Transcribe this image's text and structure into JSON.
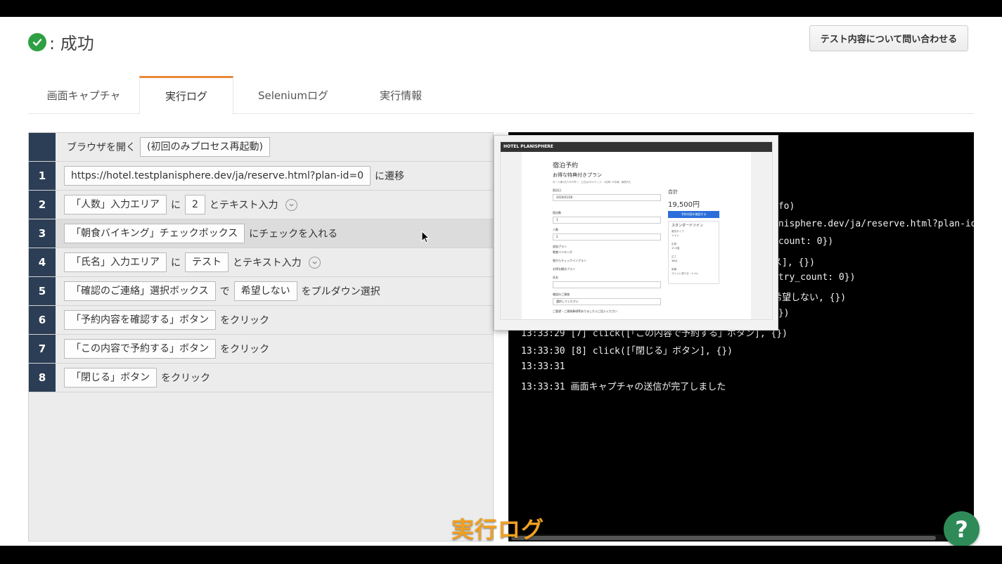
{
  "status": {
    "label": ": 成功"
  },
  "contact_button": {
    "label": "テスト内容について問い合わせる"
  },
  "tabs": [
    {
      "label": "画面キャプチャ"
    },
    {
      "label": "実行ログ",
      "active": true
    },
    {
      "label": "Seleniumログ"
    },
    {
      "label": "実行情報"
    }
  ],
  "steps": [
    {
      "num": "",
      "parts": [
        "ブラウザを開く",
        "(初回のみプロセス再起動)"
      ]
    },
    {
      "num": "1",
      "parts": [
        "https://hotel.testplanisphere.dev/ja/reserve.html?plan-id=0",
        "に遷移"
      ]
    },
    {
      "num": "2",
      "parts": [
        "「人数」入力エリア",
        "に",
        "2",
        "とテキスト入力"
      ]
    },
    {
      "num": "3",
      "parts": [
        "「朝食バイキング」チェックボックス",
        "にチェックを入れる"
      ]
    },
    {
      "num": "4",
      "parts": [
        "「氏名」入力エリア",
        "に",
        "テスト",
        "とテキスト入力"
      ]
    },
    {
      "num": "5",
      "parts": [
        "「確認のご連絡」選択ボックス",
        "で",
        "希望しない",
        "をプルダウン選択"
      ]
    },
    {
      "num": "6",
      "parts": [
        "「予約内容を確認する」ボタン",
        "をクリック"
      ]
    },
    {
      "num": "7",
      "parts": [
        "「この内容で予約する」ボタン",
        "をクリック"
      ]
    },
    {
      "num": "8",
      "parts": [
        "「閉じる」ボタン",
        "をクリック"
      ]
    }
  ],
  "log": {
    "lines": [
      "nfo)",
      "anisphere.dev/ja/reserve.html?plan-id",
      "_count: 0})",
      "ス], {})",
      "etry_count: 0})",
      "希望しない, {})",
      "{})",
      "13:33:29  [7] click([「この内容で予約する」ボタン], {})",
      "13:33:30  [8] click([「閉じる」ボタン], {})",
      "13:33:31",
      "13:33:31  画面キャプチャの送信が完了しました"
    ]
  },
  "preview": {
    "header": "HOTEL PLANISPHERE",
    "title": "宿泊予約",
    "plan": "お得な特典付きプラン",
    "desc": "お一人様1泊7,000円〜、土日は25%アップ。1名様〜9名様、最長9泊",
    "checkin_label": "宿泊日",
    "checkin_value": "2020/01/28",
    "nights_label": "宿泊数",
    "nights_value": "1",
    "guests_label": "人数",
    "guests_value": "2",
    "options_label": "追加プラン",
    "opt1": "朝食バイキング",
    "opt2": "昼からチェックインプラン",
    "opt3": "お得な観光プラン",
    "name_label": "氏名",
    "contact_label": "確認のご連絡",
    "contact_value": "選択してください",
    "note_label": "ご要望・ご連絡事項等ありましたらご記入ください",
    "total_label": "合計",
    "total_value": "19,500円",
    "confirm_button": "予約内容を確認する",
    "room_title": "スタンダードツイン",
    "room_t1": "客室タイプ",
    "room_v1": "ツイン",
    "room_t2": "定員",
    "room_v2": "1〜2名",
    "room_t3": "広さ",
    "room_v3": "18㎡",
    "room_t4": "設備",
    "room_v4": "ユニット式バス・トイレ"
  },
  "caption": {
    "label": "実行ログ"
  },
  "help_button": {
    "label": "?"
  },
  "colors": {
    "success": "#2ea043",
    "active_tab": "#e8883a",
    "step_num_bg": "#2c3e55",
    "caption": "#f0a020",
    "help": "#2e8b57"
  }
}
